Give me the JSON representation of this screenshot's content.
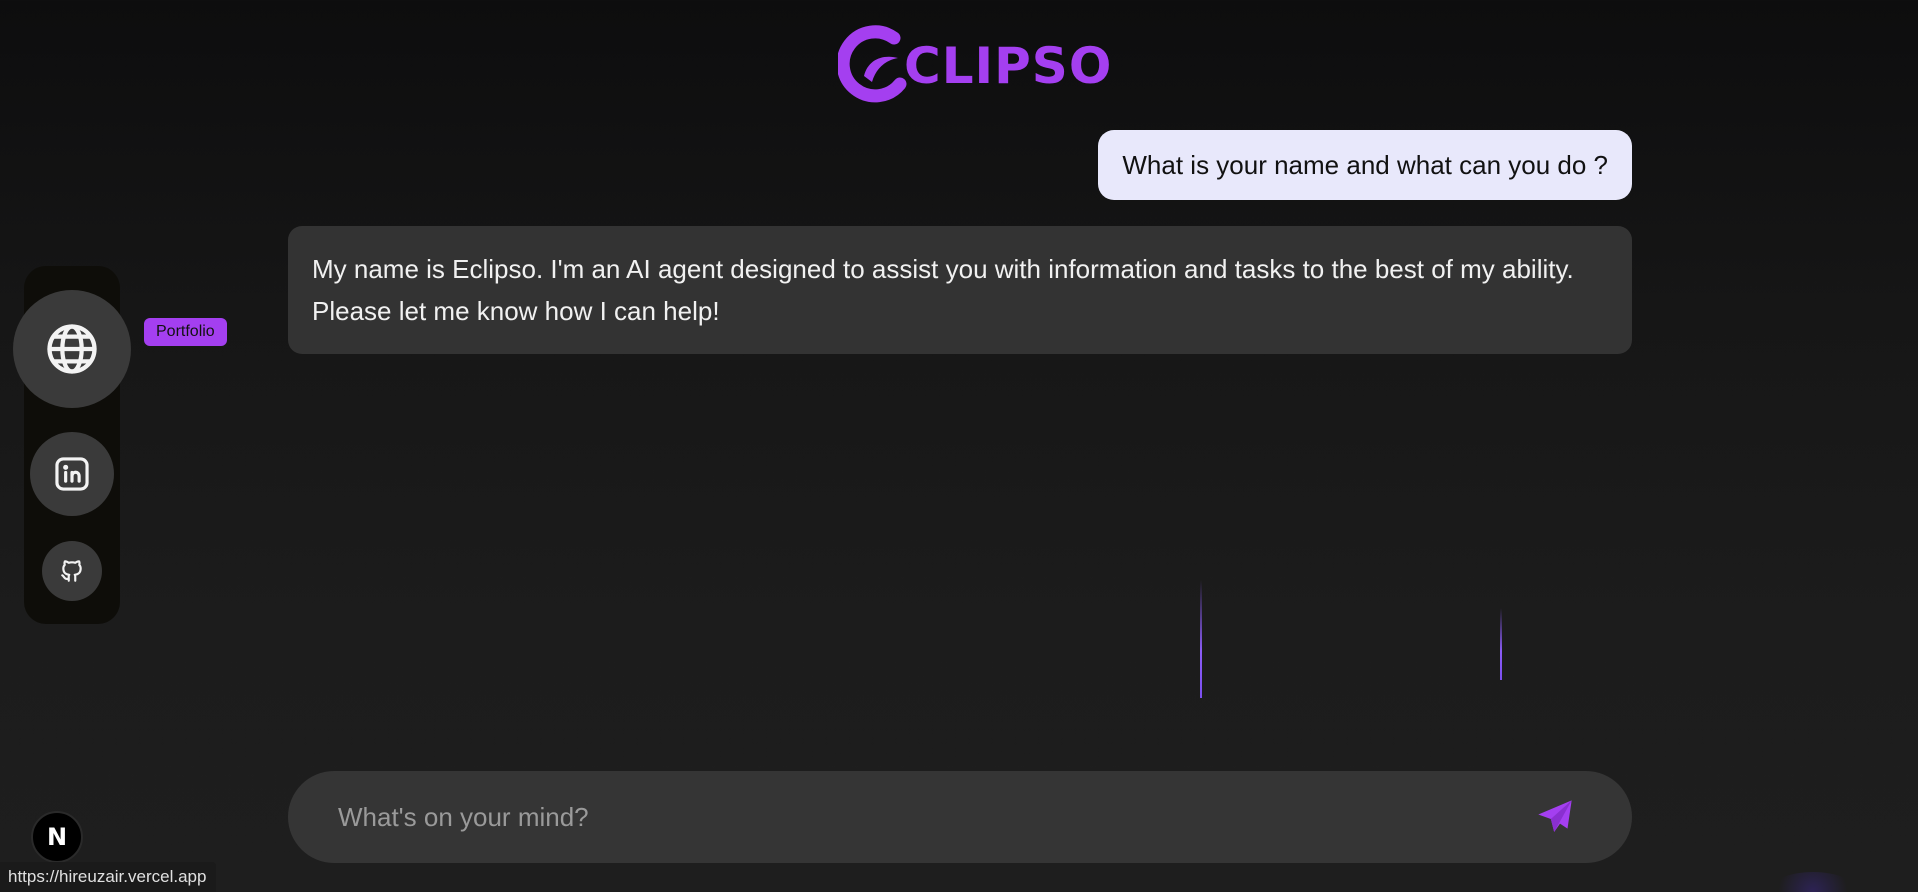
{
  "logo": {
    "text": "CLIPSO",
    "icon": "eclipso-c-icon",
    "color": "#a43ff0"
  },
  "chat": {
    "messages": [
      {
        "role": "user",
        "text": "What is your name and what can you do ?"
      },
      {
        "role": "assistant",
        "text": "My name is Eclipso. I'm an AI agent designed to assist you with information and tasks to the best of my ability. Please let me know how I can help!"
      }
    ]
  },
  "sidebar": {
    "items": [
      {
        "name": "portfolio",
        "icon": "globe-icon",
        "tooltip": "Portfolio"
      },
      {
        "name": "linkedin",
        "icon": "linkedin-icon"
      },
      {
        "name": "github",
        "icon": "github-icon"
      }
    ]
  },
  "input": {
    "placeholder": "What's on your mind?",
    "value": "",
    "send_icon": "send-icon"
  },
  "next_badge": {
    "label": "N",
    "icon": "nextjs-icon"
  },
  "status_bar": {
    "url": "https://hireuzair.vercel.app"
  },
  "colors": {
    "accent": "#a43ff0",
    "user_bubble": "#e8e8fb",
    "bot_bubble": "#333333",
    "background": "#161616"
  }
}
